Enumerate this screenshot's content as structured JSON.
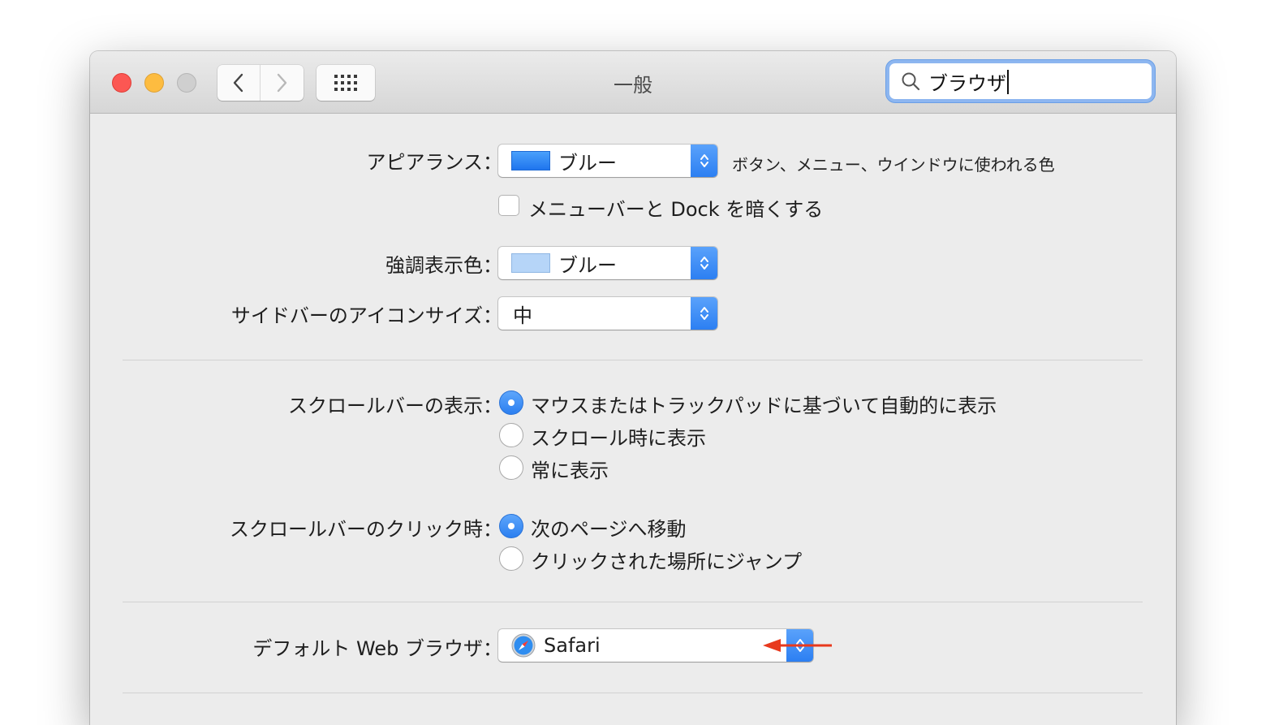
{
  "window": {
    "title": "一般"
  },
  "toolbar": {
    "search_value": "ブラウザ",
    "search_icon": "magnifier-icon",
    "back_icon": "chevron-left-icon",
    "forward_icon": "chevron-right-icon",
    "grid_icon": "show-all-grid-icon"
  },
  "appearance": {
    "label": "アピアランス：",
    "value": "ブルー",
    "swatch_color": "#2b86f5",
    "hint": "ボタン、メニュー、ウインドウに使われる色",
    "dark_menu_label": "メニューバーと Dock を暗くする",
    "dark_menu_checked": false
  },
  "highlight": {
    "label": "強調表示色：",
    "value": "ブルー",
    "swatch_color": "#b6d5f8"
  },
  "sidebar_icon_size": {
    "label": "サイドバーのアイコンサイズ：",
    "value": "中"
  },
  "show_scroll_bars": {
    "label": "スクロールバーの表示：",
    "options": [
      {
        "label": "マウスまたはトラックパッドに基づいて自動的に表示",
        "selected": true
      },
      {
        "label": "スクロール時に表示",
        "selected": false
      },
      {
        "label": "常に表示",
        "selected": false
      }
    ]
  },
  "click_in_scroll_bar": {
    "label": "スクロールバーのクリック時：",
    "options": [
      {
        "label": "次のページへ移動",
        "selected": true
      },
      {
        "label": "クリックされた場所にジャンプ",
        "selected": false
      }
    ]
  },
  "default_browser": {
    "label": "デフォルト Web ブラウザ：",
    "value": "Safari",
    "icon": "safari-compass-icon"
  },
  "colors": {
    "accent": "#2c7ff2",
    "annotation_arrow": "#e8391d"
  }
}
